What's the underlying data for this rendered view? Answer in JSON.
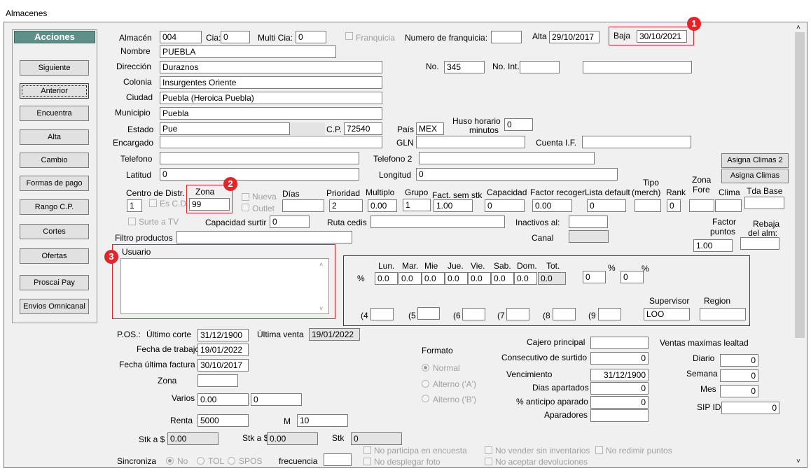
{
  "window": {
    "title": "Almacenes"
  },
  "actions": {
    "header": "Acciones",
    "buttons": [
      "Siguiente",
      "Anterior",
      "Encuentra",
      "Alta",
      "Cambio",
      "Formas de pago",
      "Rango C.P.",
      "Cortes",
      "Ofertas",
      "Proscai Pay",
      "Envios Omnicanal"
    ]
  },
  "labels": {
    "almacen": "Almacén",
    "cia": "Cia:",
    "multi_cia": "Multi Cia:",
    "franquicia": "Franquicia",
    "numero_franquicia": "Numero de franquicia:",
    "alta": "Alta",
    "baja": "Baja",
    "nombre": "Nombre",
    "direccion": "Dirección",
    "no": "No.",
    "no_int": "No. Int.",
    "colonia": "Colonia",
    "ciudad": "Ciudad",
    "municipio": "Municipio",
    "estado": "Estado",
    "cp": "C.P.",
    "pais": "País",
    "huso1": "Huso horario",
    "huso2": "minutos",
    "encargado": "Encargado",
    "gln": "GLN",
    "cuenta_if": "Cuenta I.F.",
    "telefono": "Telefono",
    "telefono2": "Telefono 2",
    "latitud": "Latitud",
    "longitud": "Longitud",
    "centro_distr": "Centro de Distr.",
    "es_cd": "Es C.D.",
    "zona": "Zona",
    "nueva": "Nueva",
    "outlet": "Outlet",
    "dias": "Días",
    "prioridad": "Prioridad",
    "multiplo": "Multiplo",
    "grupo": "Grupo",
    "fact_sem_stk": "Fact. sem stk",
    "capacidad": "Capacidad",
    "factor_recoger": "Factor recoger",
    "lista_default": "Lista default",
    "tipo": "Tipo",
    "merch": "(merch)",
    "rank": "Rank",
    "zona_fore1": "Zona",
    "zona_fore2": "Fore",
    "clima": "Clima",
    "tda_base": "Tda Base",
    "surte_tv": "Surte a TV",
    "capacidad_surtir": "Capacidad surtir",
    "ruta_cedis": "Ruta cedis",
    "inactivos": "Inactivos al:",
    "factor_puntos1": "Factor",
    "factor_puntos2": "puntos",
    "rebaja1": "Rebaja",
    "rebaja2": "del alm:",
    "filtro_productos": "Filtro productos",
    "canal": "Canal",
    "usuario": "Usuario",
    "pct": "%",
    "supervisor": "Supervisor",
    "region": "Region",
    "pos": "P.OS.:",
    "ultimo_corte": "Último corte",
    "ultima_venta": "Última venta",
    "fecha_trabajo": "Fecha de trabajo",
    "fecha_ultima_factura": "Fecha última factura",
    "zona2": "Zona",
    "varios": "Varios",
    "renta": "Renta",
    "m": "M",
    "stk_a_1": "Stk a $",
    "stk_a_2": "Stk a $",
    "stk": "Stk",
    "formato": "Formato",
    "normal": "Normal",
    "alterno_a": "Alterno ('A')",
    "alterno_b": "Alterno ('B')",
    "cajero_principal": "Cajero principal",
    "consecutivo_surtido": "Consecutivo de surtido",
    "vencimiento": "Vencimiento",
    "dias_apartados": "Dias apartados",
    "anticipo_aparado": "% anticipo aparado",
    "aparadores": "Aparadores",
    "ventas_max": "Ventas maximas lealtad",
    "diario": "Diario",
    "semana": "Semana",
    "mes": "Mes",
    "sip_id": "SIP ID",
    "no_participa": "No participa en encuesta",
    "no_desplegar": "No desplegar foto",
    "no_vender": "No vender sin inventarios",
    "no_aceptar": "No aceptar devoluciones",
    "no_redimir": "No redimir puntos",
    "sincroniza": "Sincroniza",
    "no_opt": "No",
    "tol_opt": "TOL",
    "spos_opt": "SPOS",
    "frecuencia": "frecuencia"
  },
  "values": {
    "almacen": "004",
    "cia": "0",
    "multi_cia": "0",
    "numero_franquicia": "",
    "alta": "29/10/2017",
    "baja": "30/10/2021",
    "nombre": "PUEBLA",
    "direccion": "Duraznos",
    "no": "345",
    "no_int": "",
    "extra": "",
    "colonia": "Insurgentes Oriente",
    "ciudad": "Puebla (Heroica Puebla)",
    "municipio": "Puebla",
    "estado": "Pue",
    "cp": "72540",
    "pais": "MEX",
    "huso": "0",
    "encargado": "",
    "gln": "",
    "cuenta_if": "",
    "telefono": "",
    "telefono2": "",
    "latitud": "0",
    "longitud": "0",
    "centro_distr": "1",
    "zona": "99",
    "dias": "",
    "prioridad": "2",
    "multiplo": "0.00",
    "grupo": "1",
    "fact_sem_stk": "1.00",
    "capacidad": "0",
    "factor_recoger": "0.00",
    "lista_default": "0",
    "tipo": "",
    "rank": "0",
    "zona_fore": "",
    "clima": "",
    "tda_base": "",
    "capacidad_surtir": "0",
    "ruta_cedis": "",
    "inactivos": "",
    "factor_puntos": "1.00",
    "rebaja": "",
    "filtro_productos": "",
    "canal": "",
    "usuario": "",
    "supervisor": "LOO",
    "region": "",
    "ultimo_corte": "31/12/1900",
    "ultima_venta": "19/01/2022",
    "fecha_trabajo": "19/01/2022",
    "fecha_ultima_factura": "30/10/2017",
    "zona2": "",
    "varios1": "0.00",
    "varios2": "0",
    "renta": "5000",
    "m": "10",
    "stk_a_1": "0.00",
    "stk_a_2": "0.00",
    "stk": "0",
    "cajero_principal": "",
    "consecutivo_surtido": "0",
    "vencimiento": "31/12/1900",
    "dias_apartados": "0",
    "anticipo_aparado": "0",
    "aparadores": "",
    "diario": "0",
    "semana": "0",
    "mes": "0",
    "sip_id": "0",
    "frecuencia": ""
  },
  "days": {
    "headers": [
      "Lun.",
      "Mar.",
      "Mie",
      "Jue.",
      "Vie.",
      "Sab.",
      "Dom.",
      "Tot."
    ],
    "values": [
      "0.0",
      "0.0",
      "0.0",
      "0.0",
      "0.0",
      "0.0",
      "0.0",
      "0.0"
    ],
    "pct1": "0",
    "pct2": "0",
    "paren_labels": [
      "(4",
      "(5",
      "(6",
      "(7",
      "(8",
      "(9"
    ]
  },
  "side_buttons": [
    "Asigna Climas 2",
    "Asigna Climas"
  ],
  "annotations": [
    "1",
    "2",
    "3"
  ],
  "colors": {
    "highlight": "#e0262b",
    "actions_header": "#5f8f89"
  }
}
